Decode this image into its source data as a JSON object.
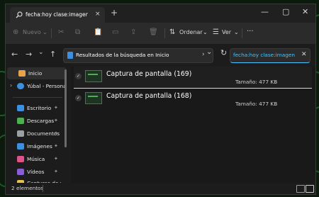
{
  "window": {
    "tab_title": "fecha:hoy clase:imagen - Resu",
    "tab_close": "×",
    "new_tab": "+",
    "minimize": "—",
    "maximize": "▢",
    "close": "✕"
  },
  "toolbar": {
    "new_label": "Nuevo",
    "new_chevron": "⌄",
    "sort_label": "Ordenar",
    "sort_chevron": "⌄",
    "view_label": "Ver",
    "view_chevron": "⌄",
    "more": "···"
  },
  "address": {
    "back": "←",
    "forward": "→",
    "dropdown": "⌄",
    "up": "↑",
    "path": "Resultados de la búsqueda en Inicio",
    "path_chevron": "›",
    "pre_chevron": "›",
    "history_dropdown": "⌄",
    "refresh": "↻"
  },
  "search": {
    "value": "fecha:hoy clase:imagen",
    "clear": "✕"
  },
  "sidebar": {
    "items": [
      {
        "label": "Inicio",
        "icon": "home-icon",
        "color": "#e8a34a",
        "active": true
      },
      {
        "label": "Yúbal - Personal",
        "icon": "cloud-icon",
        "color": "#3d8fe0",
        "chevron": "›"
      },
      {
        "label": "Escritorio",
        "icon": "desktop-icon",
        "color": "#3d8fe0",
        "pin": "📌"
      },
      {
        "label": "Descargas",
        "icon": "download-icon",
        "color": "#4caf50",
        "pin": "📌"
      },
      {
        "label": "Documentos",
        "icon": "documents-icon",
        "color": "#9aa0a6",
        "pin": "📌"
      },
      {
        "label": "Imágenes",
        "icon": "pictures-icon",
        "color": "#3d8fe0",
        "pin": "📌"
      },
      {
        "label": "Música",
        "icon": "music-icon",
        "color": "#e0528a",
        "pin": "📌"
      },
      {
        "label": "Vídeos",
        "icon": "videos-icon",
        "color": "#8a5cd6",
        "pin": "📌"
      },
      {
        "label": "Capturas de pan",
        "icon": "folder-icon",
        "color": "#e8c24a"
      }
    ]
  },
  "results": [
    {
      "name": "Captura de pantalla (169)",
      "size": "Tamaño: 477 KB",
      "check": "✓"
    },
    {
      "name": "Captura de pantalla (168)",
      "size": "Tamaño: 477 KB",
      "check": "✓"
    }
  ],
  "status": {
    "count": "2 elementos"
  },
  "colors": {
    "accent": "#4cc2ff",
    "window_bg": "#1c1c1c"
  }
}
